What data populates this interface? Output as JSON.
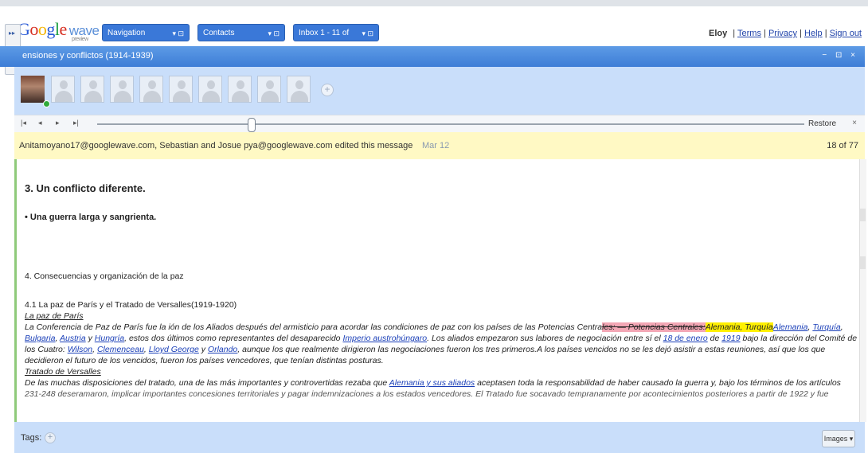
{
  "header": {
    "logo_text": "Google wave",
    "logo_sub": "preview",
    "nav_buttons": [
      {
        "label": "Navigation",
        "ctl": "▾ ⊡"
      },
      {
        "label": "Contacts",
        "ctl": "▾ ⊡"
      },
      {
        "label": "Inbox 1 - 11 of",
        "ctl": "▾ ⊡"
      }
    ],
    "user": "Eloy",
    "links": [
      "Terms",
      "Privacy",
      "Help",
      "Sign out"
    ]
  },
  "wave": {
    "title": "ensiones y conflictos (1914-1939)",
    "window_controls": "− ⊡ ×",
    "participants_count": 10,
    "add_participant": "+",
    "playback": {
      "buttons": [
        "|◂",
        "◂",
        "▸",
        "▸|"
      ],
      "restore_label": "Restore",
      "close_label": "×",
      "position": 0.21
    },
    "edit_info": {
      "editors": "Anitamoyano17@googlewave.com, Sebastian and Josue pya@googlewave.com edited this message",
      "date": "Mar 12",
      "count": "18 of 77"
    }
  },
  "doc": {
    "heading": "3. Un conflicto diferente.",
    "bullet": "• Una guerra larga y sangrienta.",
    "section4": "4. Consecuencias y organización de la paz",
    "section41": "4.1 La paz de París y el Tratado de Versalles(1919-1920)",
    "sub1": "La paz de París",
    "p1a": "La Conferencia de Paz de París fue la ión de los  Aliados después del armisticio para acordar las condiciones de paz con los países de las Potencias Centra",
    "p1_strike": "les:  —  Potencias Centrales:",
    "p1_yellow": "Alemania,  Turquía",
    "p1_link1": "Alemania",
    "p1_link2": "Turquía",
    "p2_link1": "Bulgaria",
    "p2_link2": "Austria",
    "p2_link3": "Hungría",
    "p2_mid": ", estos dos últimos como representantes del desaparecido ",
    "p2_link4": "Imperio austrohúngaro",
    "p2_mid2": ". Los aliados empezaron sus labores de negociación entre sí el ",
    "p2_link5": "18 de enero",
    "p2_link6": "1919",
    "p2_end": " bajo la dirección del Comité de",
    "p3_start": "los Cuatro: ",
    "p3_link1": "Wilson",
    "p3_link2": "Clemenceau",
    "p3_link3": "Lloyd George",
    "p3_link4": "Orlando",
    "p3_end": ", aunque los que realmente dirigieron las negociaciones fueron los tres primeros.A los países vencidos no se les dejó asistir a estas reuniones, así que los que",
    "p4": "decidieron el futuro de los vencidos, fueron los países vencedores, que tenían distintas posturas.",
    "sub2": "Tratado de Versalles",
    "p5a": "De las muchas disposiciones del tratado, una de las más importantes y controvertidas rezaba que ",
    "p5_link": "Alemania y sus aliados",
    "p5b": " aceptasen toda la responsabilidad de haber causado la guerra y, bajo los términos de los artículos",
    "p6": "231-248 deseramaron, implicar importantes concesiones territoriales y pagar indemnizaciones a los estados vencedores. El Tratado fue socavado tempranamente por acontecimientos posteriores a partir de 1922 y fue"
  },
  "footer": {
    "tags_label": "Tags:",
    "tags_add": "+",
    "images_label": "Images ▾"
  }
}
